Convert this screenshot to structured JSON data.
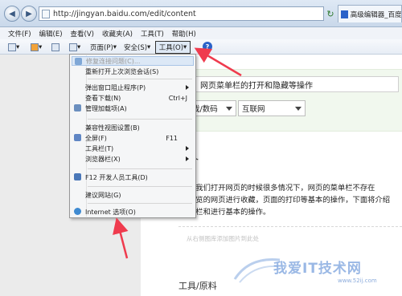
{
  "address_bar": {
    "url": "http://jingyan.baidu.com/edit/content",
    "tab_title": "高级编辑器_百度经"
  },
  "menu": [
    "文件(F)",
    "编辑(E)",
    "查看(V)",
    "收藏夹(A)",
    "工具(T)",
    "帮助(H)"
  ],
  "command_bar": {
    "page_label": "页面(P)",
    "safety_label": "安全(S)",
    "tools_label": "工具(O)"
  },
  "tools_menu": [
    {
      "label": "修复连接问题(C)...",
      "disabled": true
    },
    {
      "label": "重新打开上次浏览会话(S)"
    },
    {
      "label": "弹出窗口阻止程序(P)",
      "submenu": true
    },
    {
      "label": "查看下载(N)",
      "shortcut": "Ctrl+J"
    },
    {
      "label": "管理加载项(A)"
    },
    {
      "label": "兼容性视图设置(B)"
    },
    {
      "label": "全屏(F)",
      "shortcut": "F11"
    },
    {
      "label": "工具栏(T)",
      "submenu": true
    },
    {
      "label": "浏览器栏(X)",
      "submenu": true
    },
    {
      "label": "F12 开发人员工具(D)"
    },
    {
      "label": "建议网站(G)"
    },
    {
      "label": "Internet 选项(O)"
    }
  ],
  "page": {
    "title_value": "：网页菜单栏的打开和隐藏等操作",
    "category1": "戏/数码",
    "category2": "互联网",
    "section_heading": "介",
    "paragraph_line1": "在我们打开网页的时候很多情况下，网页的菜单栏不存在",
    "paragraph_line2": "浏览的网页进行收藏，页面的打印等基本的操作，下面将介绍",
    "paragraph_line3": "单栏和进行基本的操作。",
    "image_hint": "从右侧图库添加图片到此处",
    "tools_heading": "工具/原料"
  },
  "watermark": {
    "brand": "我爱IT技术网",
    "site": "www.52ij.com"
  },
  "colors": {
    "arrow": "#ef3b4e",
    "highlight": "#dce8f6"
  }
}
